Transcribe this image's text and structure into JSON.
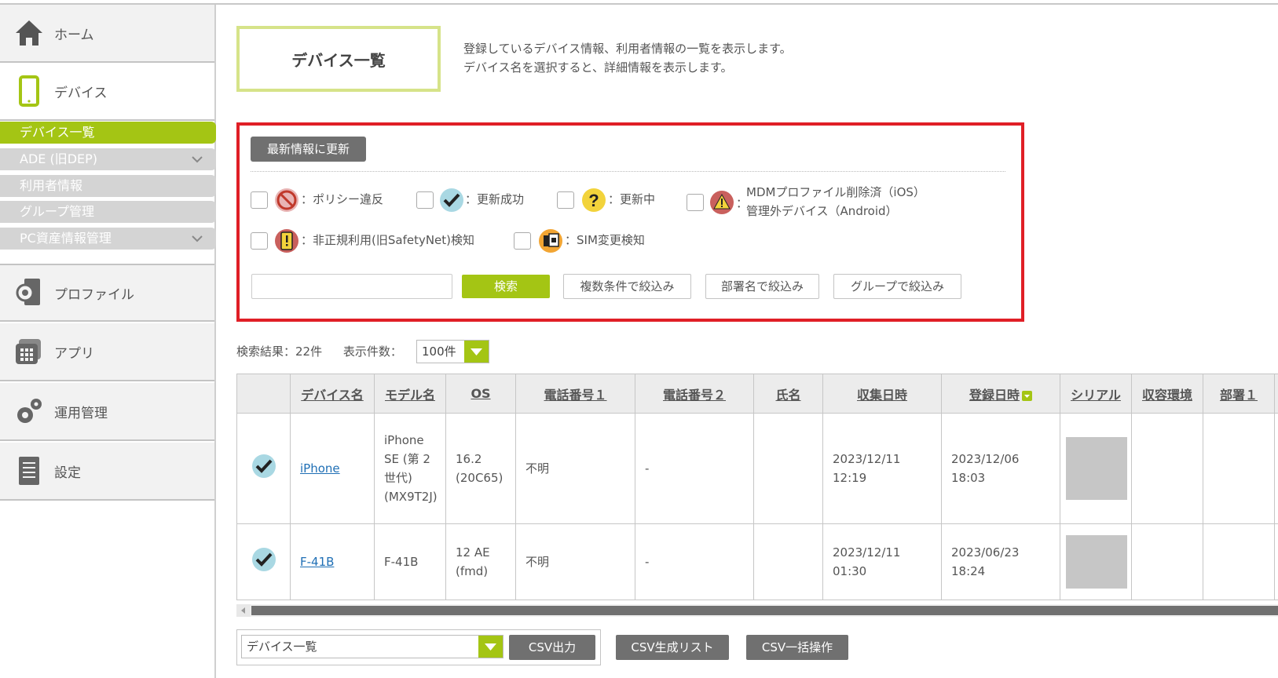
{
  "sidebar": {
    "home": "ホーム",
    "device": "デバイス",
    "device_sub": [
      "デバイス一覧",
      "ADE (旧DEP)",
      "利用者情報",
      "グループ管理",
      "PC資産情報管理"
    ],
    "profile": "プロファイル",
    "app": "アプリ",
    "ops": "運用管理",
    "settings": "設定"
  },
  "header": {
    "title": "デバイス一覧",
    "desc_line1": "登録しているデバイス情報、利用者情報の一覧を表示します。",
    "desc_line2": "デバイス名を選択すると、詳細情報を表示します。"
  },
  "filters": {
    "refresh_label": "最新情報に更新",
    "status": {
      "policy_violation": "：ポリシー違反",
      "update_success": "：更新成功",
      "updating": "：更新中",
      "mdm_removed_line1": "MDMプロファイル削除済（iOS）",
      "mdm_removed_line2": "管理外デバイス（Android）",
      "unauthorized": "：非正規利用(旧SafetyNet)検知",
      "sim_change": "：SIM変更検知"
    },
    "search_placeholder": "",
    "search_button": "検索",
    "multi_filter": "複数条件で絞込み",
    "dept_filter": "部署名で絞込み",
    "group_filter": "グループで絞込み"
  },
  "results": {
    "count_label": "検索結果：22件",
    "per_page_label": "表示件数：",
    "per_page_value": "100件"
  },
  "table": {
    "columns": [
      "デバイス名",
      "モデル名",
      "OS",
      "電話番号１",
      "電話番号２",
      "氏名",
      "収集日時",
      "登録日時",
      "シリアル",
      "収容環境",
      "部署１"
    ],
    "rows": [
      {
        "name": "iPhone",
        "model": "iPhone SE (第 2 世代) (MX9T2J)",
        "os": "16.2 (20C65)",
        "phone1": "不明",
        "phone2": "-",
        "person": "",
        "collected": "2023/12/11 12:19",
        "registered": "2023/12/06 18:03",
        "env": "",
        "dept": ""
      },
      {
        "name": "F-41B",
        "model": "F-41B",
        "os": "12 AE (fmd)",
        "phone1": "不明",
        "phone2": "-",
        "person": "",
        "collected": "2023/12/11 01:30",
        "registered": "2023/06/23 18:24",
        "env": "",
        "dept": ""
      }
    ]
  },
  "bottom": {
    "select_value": "デバイス一覧",
    "csv_output": "CSV出力",
    "csv_list": "CSV生成リスト",
    "csv_bulk": "CSV一括操作"
  },
  "colors": {
    "accent": "#a4c514",
    "highlight_border": "#e01f26",
    "link": "#1f6fb5"
  }
}
